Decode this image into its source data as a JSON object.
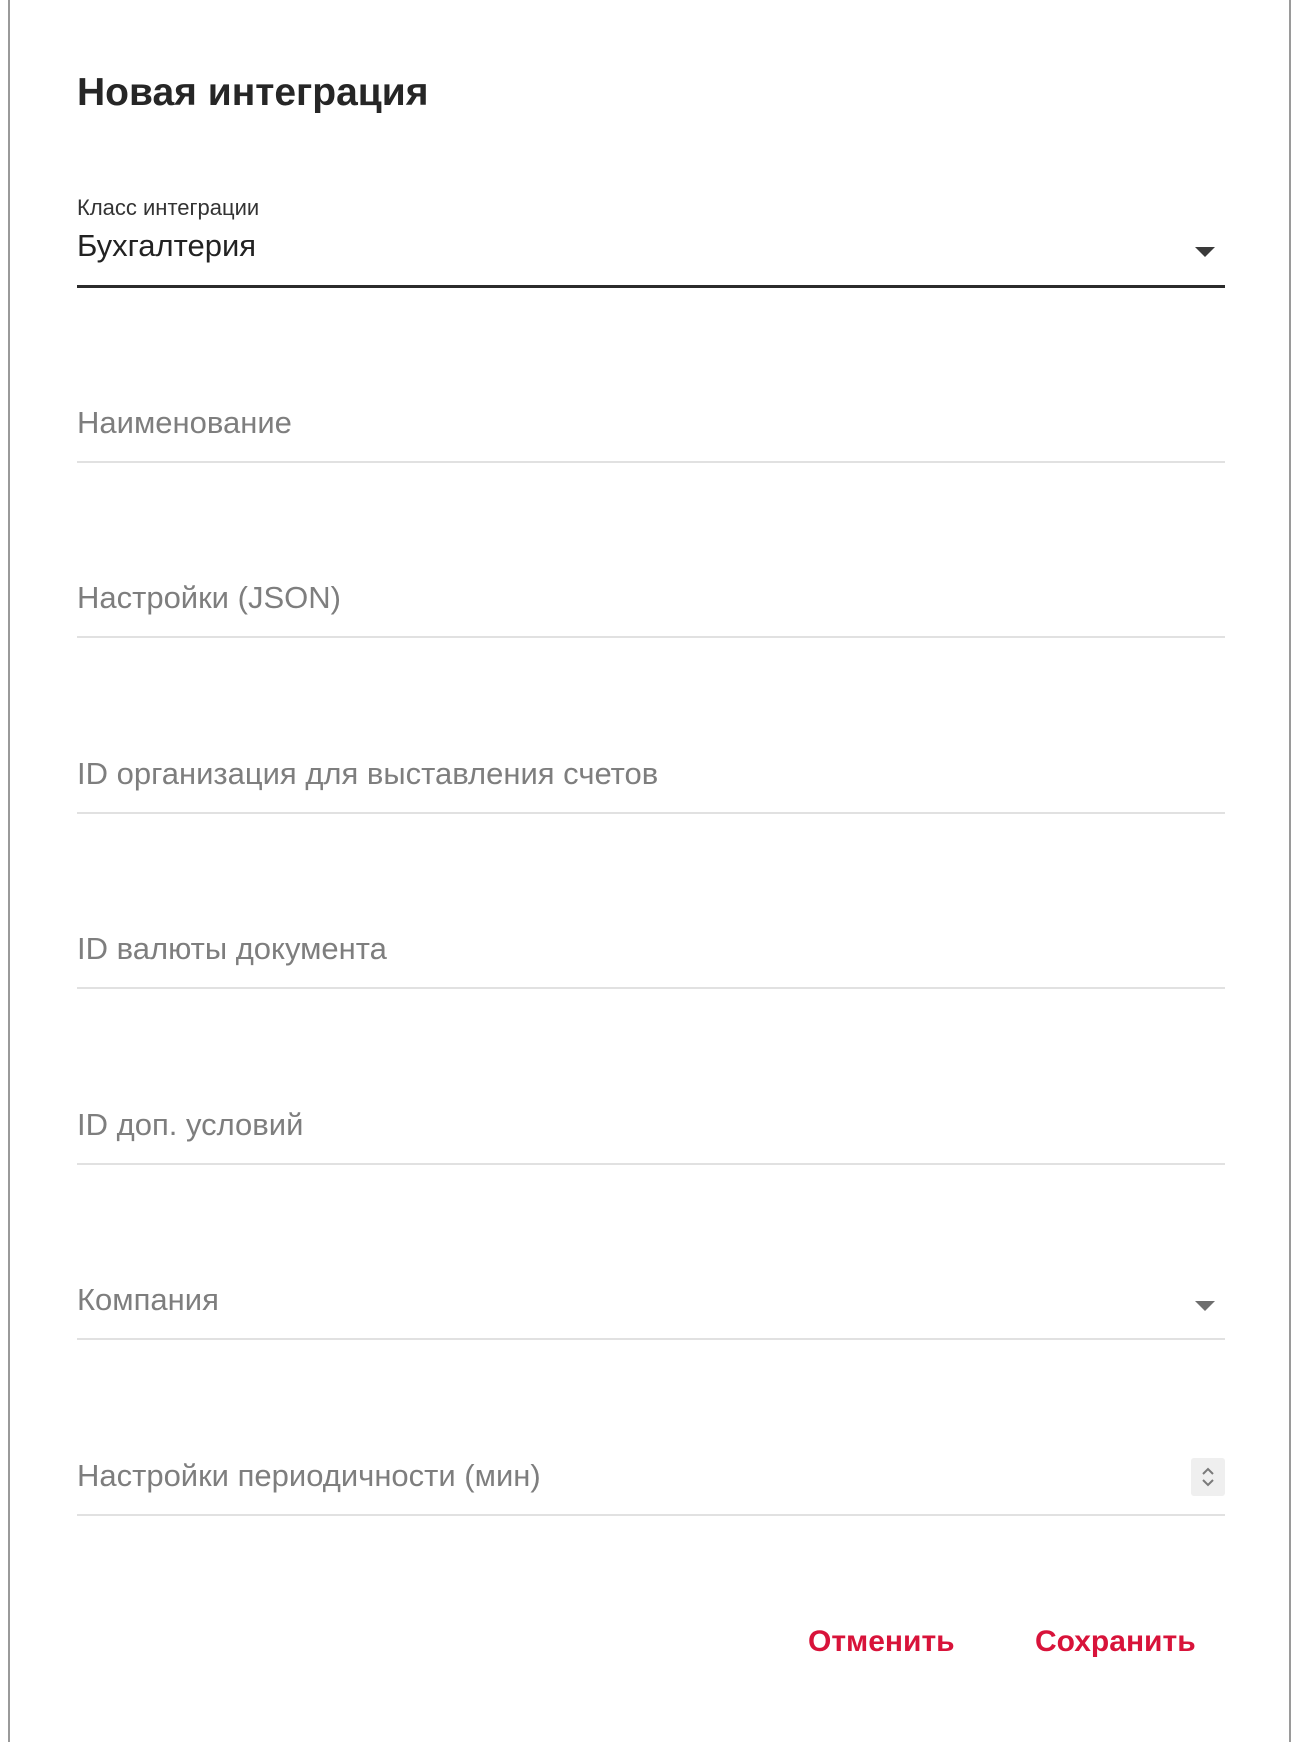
{
  "dialog": {
    "title": "Новая интеграция"
  },
  "fields": {
    "integration_class": {
      "label": "Класс интеграции",
      "value": "Бухгалтерия",
      "icon": "chevron-down-icon"
    },
    "name": {
      "placeholder": "Наименование"
    },
    "settings_json": {
      "placeholder": "Настройки (JSON)"
    },
    "billing_org_id": {
      "placeholder": "ID организация для выставления счетов"
    },
    "currency_id": {
      "placeholder": "ID валюты документа"
    },
    "extra_terms_id": {
      "placeholder": "ID доп. условий"
    },
    "company": {
      "placeholder": "Компания",
      "icon": "chevron-down-icon"
    },
    "interval": {
      "placeholder": "Настройки периодичности (мин)",
      "icon": "stepper-icon"
    }
  },
  "actions": {
    "cancel_label": "Отменить",
    "save_label": "Сохранить"
  },
  "colors": {
    "accent": "#d8133a",
    "active_underline": "#2b2b2b",
    "inactive_underline": "#e1e1e1",
    "placeholder": "#7e7e7e"
  }
}
